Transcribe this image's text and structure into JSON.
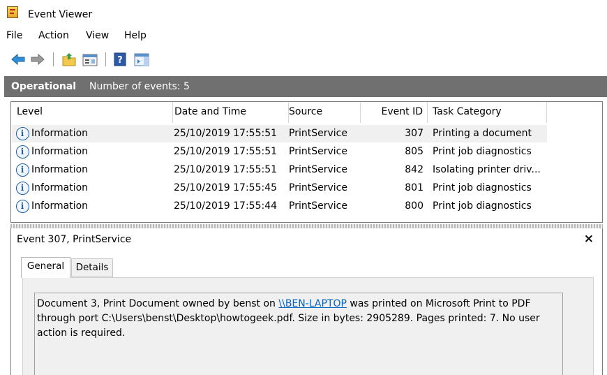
{
  "window": {
    "title": "Event Viewer"
  },
  "menu": [
    "File",
    "Action",
    "View",
    "Help"
  ],
  "toolbar": {
    "icons": [
      "back-arrow-icon",
      "forward-arrow-icon",
      "up-folder-icon",
      "properties-icon",
      "help-icon",
      "show-hide-pane-icon"
    ]
  },
  "header": {
    "title": "Operational",
    "count_text": "Number of events: 5"
  },
  "columns": [
    "Level",
    "Date and Time",
    "Source",
    "Event ID",
    "Task Category"
  ],
  "rows": [
    {
      "level": "Information",
      "datetime": "25/10/2019 17:55:51",
      "source": "PrintService",
      "event_id": "307",
      "task": "Printing a document"
    },
    {
      "level": "Information",
      "datetime": "25/10/2019 17:55:51",
      "source": "PrintService",
      "event_id": "805",
      "task": "Print job diagnostics"
    },
    {
      "level": "Information",
      "datetime": "25/10/2019 17:55:51",
      "source": "PrintService",
      "event_id": "842",
      "task": "Isolating printer driv..."
    },
    {
      "level": "Information",
      "datetime": "25/10/2019 17:55:45",
      "source": "PrintService",
      "event_id": "801",
      "task": "Print job diagnostics"
    },
    {
      "level": "Information",
      "datetime": "25/10/2019 17:55:44",
      "source": "PrintService",
      "event_id": "800",
      "task": "Print job diagnostics"
    }
  ],
  "detail": {
    "title": "Event 307, PrintService",
    "close": "×",
    "tabs": [
      "General",
      "Details"
    ],
    "message": {
      "part1": "Document 3, Print Document owned by benst on ",
      "link": "\\\\BEN-LAPTOP",
      "part2": " was printed on Microsoft Print to PDF through port C:\\Users\\benst\\Desktop\\howtogeek.pdf. Size in bytes: 2905289. Pages printed: 7. No user action is required."
    }
  },
  "colors": {
    "header_band": "#707070",
    "selected_row": "#f0f0f0",
    "link": "#0563c1"
  }
}
